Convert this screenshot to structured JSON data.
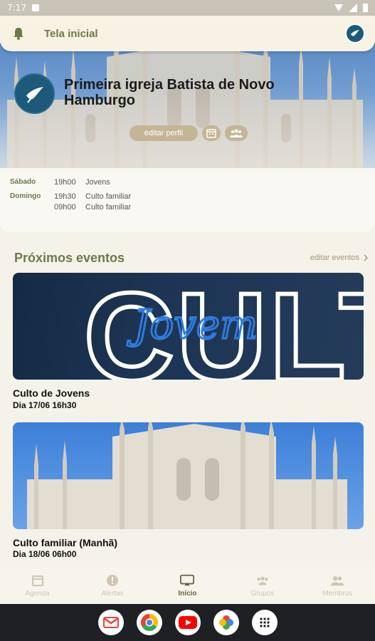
{
  "status_bar": {
    "time": "7:17"
  },
  "app_bar": {
    "title": "Tela inicial"
  },
  "church": {
    "name": "Primeira igreja Batista de Novo Hamburgo",
    "edit_profile_label": "editar perfil"
  },
  "schedule": [
    {
      "day": "Sábado",
      "events": [
        {
          "time": "19h00",
          "name": "Jovens"
        }
      ]
    },
    {
      "day": "Domingo",
      "events": [
        {
          "time": "19h30",
          "name": "Culto familiar"
        },
        {
          "time": "09h00",
          "name": "Culto familiar"
        }
      ]
    }
  ],
  "events_section": {
    "title": "Próximos eventos",
    "edit_label": "editar eventos"
  },
  "events": [
    {
      "title": "Culto de Jovens",
      "date": "Dia 17/06 16h30",
      "banner_text_1": "CULTO",
      "banner_text_2": "Jovem"
    },
    {
      "title": "Culto familiar (Manhã)",
      "date": "Dia 18/06 06h00"
    }
  ],
  "bottom_nav": [
    {
      "label": "Agenda",
      "icon": "calendar-icon",
      "active": false
    },
    {
      "label": "Alertas",
      "icon": "alert-icon",
      "active": false
    },
    {
      "label": "Início",
      "icon": "home-icon",
      "active": true
    },
    {
      "label": "Grupos",
      "icon": "groups-icon",
      "active": false
    },
    {
      "label": "Membros",
      "icon": "members-icon",
      "active": false
    }
  ],
  "dock_apps": [
    "gmail-icon",
    "chrome-icon",
    "youtube-icon",
    "photos-icon",
    "app-drawer-icon"
  ],
  "colors": {
    "accent_olive": "#6b7a4c",
    "pill_tan": "#c4b596",
    "logo_blue": "#1d5a7a",
    "background": "#f5f2ea"
  }
}
